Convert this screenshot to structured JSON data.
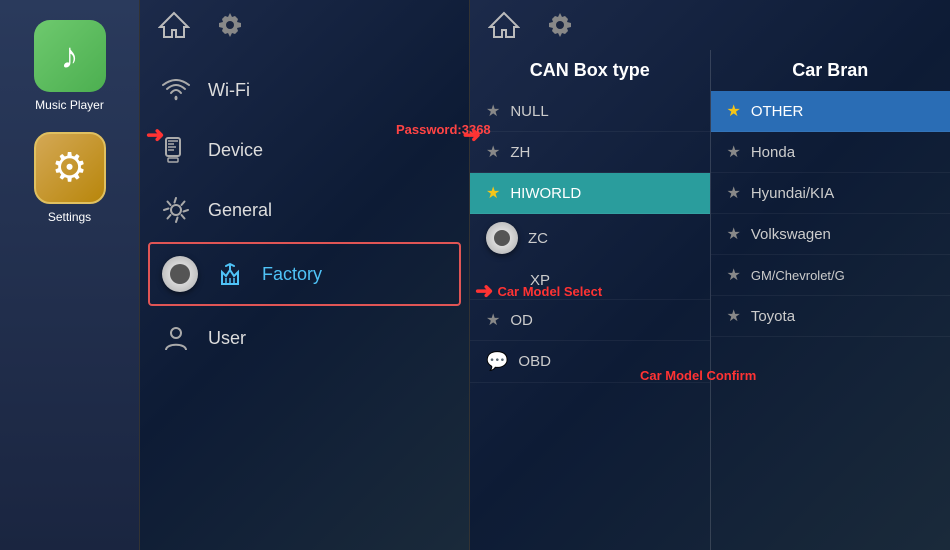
{
  "sidebar": {
    "apps": [
      {
        "id": "music-player",
        "label": "Music Player",
        "icon_type": "music",
        "icon_color": "#4caf50"
      },
      {
        "id": "settings",
        "label": "Settings",
        "icon_type": "settings",
        "icon_color": "#d4a855",
        "active": true
      }
    ]
  },
  "settings_panel": {
    "topbar": {
      "home_icon": "🏠",
      "gear_icon": "⚙"
    },
    "password_label": "Password:3368",
    "menu_items": [
      {
        "id": "wifi",
        "label": "Wi-Fi",
        "icon": "📶"
      },
      {
        "id": "device",
        "label": "Device",
        "icon": "📱"
      },
      {
        "id": "general",
        "label": "General",
        "icon": "⚙"
      },
      {
        "id": "factory",
        "label": "Factory",
        "icon": "🔧",
        "active": true
      },
      {
        "id": "user",
        "label": "User",
        "icon": "👤"
      }
    ]
  },
  "right_panel": {
    "topbar": {
      "home_icon": "🏠",
      "gear_icon": "⚙"
    },
    "can_box": {
      "header": "CAN Box type",
      "items": [
        {
          "id": "null",
          "label": "NULL",
          "star": "gray",
          "selected": false
        },
        {
          "id": "zh",
          "label": "ZH",
          "star": "gray",
          "selected": false
        },
        {
          "id": "hiworld",
          "label": "HIWORLD",
          "star": "yellow",
          "selected": true
        },
        {
          "id": "zc",
          "label": "ZC",
          "star": "none",
          "selected": false
        },
        {
          "id": "xp",
          "label": "XP",
          "star": "none",
          "selected": false
        },
        {
          "id": "od",
          "label": "OD",
          "star": "gray",
          "selected": false
        },
        {
          "id": "obd",
          "label": "OBD",
          "star": "msg",
          "selected": false
        }
      ]
    },
    "car_brand": {
      "header": "Car Bran",
      "items": [
        {
          "id": "other",
          "label": "OTHER",
          "star": "yellow",
          "selected": true
        },
        {
          "id": "honda",
          "label": "Honda",
          "star": "gray",
          "selected": false
        },
        {
          "id": "hyundai",
          "label": "Hyundai/KIA",
          "star": "gray",
          "selected": false
        },
        {
          "id": "volkswagen",
          "label": "Volkswagen",
          "star": "gray",
          "selected": false
        },
        {
          "id": "gm",
          "label": "GM/Chevrolet/G",
          "star": "gray",
          "selected": false
        },
        {
          "id": "toyota",
          "label": "Toyota",
          "star": "gray",
          "selected": false
        }
      ]
    }
  },
  "annotations": {
    "car_model_select": "Car Model Select",
    "car_model_confirm": "Car Model Confirm"
  }
}
